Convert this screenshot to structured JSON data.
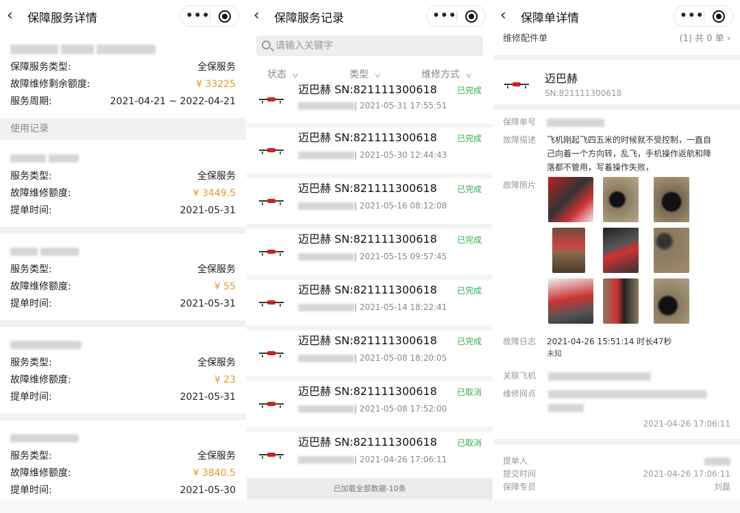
{
  "panel1": {
    "title": "保障服务详情",
    "rows": [
      {
        "label": "保障服务类型:",
        "value": "全保服务"
      },
      {
        "label": "故障维修剩余额度:",
        "value": "¥ 33225"
      },
      {
        "label": "服务周期:",
        "value": "2021-04-21 ~ 2022-04-21"
      }
    ],
    "section_title": "使用记录",
    "records": [
      {
        "type_label": "服务类型:",
        "type": "全保服务",
        "amount_label": "故障维修额度:",
        "amount": "¥ 3449.5",
        "time_label": "提单时间:",
        "time": "2021-05-31"
      },
      {
        "type_label": "服务类型:",
        "type": "全保服务",
        "amount_label": "故障维修额度:",
        "amount": "¥ 55",
        "time_label": "提单时间:",
        "time": "2021-05-31"
      },
      {
        "type_label": "服务类型:",
        "type": "全保服务",
        "amount_label": "故障维修额度:",
        "amount": "¥ 23",
        "time_label": "提单时间:",
        "time": "2021-05-31"
      },
      {
        "type_label": "服务类型:",
        "type": "全保服务",
        "amount_label": "故障维修额度:",
        "amount": "¥ 3840.5",
        "time_label": "提单时间:",
        "time": "2021-05-30"
      }
    ]
  },
  "panel2": {
    "title": "保障服务记录",
    "search_placeholder": "请输入关键字",
    "filters": [
      "状态",
      "类型",
      "维修方式"
    ],
    "items": [
      {
        "title": "迈巴赫 SN:821111300618",
        "time": "| 2021-05-31 17:55:51",
        "status": "已完成"
      },
      {
        "title": "迈巴赫 SN:821111300618",
        "time": "| 2021-05-30 12:44:43",
        "status": "已完成"
      },
      {
        "title": "迈巴赫 SN:821111300618",
        "time": "| 2021-05-16 08:12:08",
        "status": "已完成"
      },
      {
        "title": "迈巴赫 SN:821111300618",
        "time": "| 2021-05-15 09:57:45",
        "status": "已完成"
      },
      {
        "title": "迈巴赫 SN:821111300618",
        "time": "| 2021-05-14 18:22:41",
        "status": "已完成"
      },
      {
        "title": "迈巴赫 SN:821111300618",
        "time": "| 2021-05-08 18:20:05",
        "status": "已完成"
      },
      {
        "title": "迈巴赫 SN:821111300618",
        "time": "| 2021-05-08 17:52:00",
        "status": "已取消"
      },
      {
        "title": "迈巴赫 SN:821111300618",
        "time": "| 2021-04-26 17:06:11",
        "status": "已取消"
      }
    ],
    "footer": "已加载全部数据-10条"
  },
  "panel3": {
    "title": "保障单详情",
    "parts_label": "维修配件单",
    "parts_count": "(1) 共 0 单 ›",
    "drone_name": "迈巴赫",
    "drone_sn": "SN:821111300618",
    "labels": {
      "order_no": "保障单号",
      "fault_desc": "故障描述",
      "fault_photos": "故障照片",
      "fault_log": "故障日志",
      "linked_drone": "关联飞机",
      "repair_site": "维修网点",
      "submitter": "提单人",
      "submit_time": "提交时间",
      "specialist": "保障专员"
    },
    "fault_desc_lines": [
      "飞机刚起飞四五米的时候就不受控制，一直自",
      "己向着一个方向转，乱飞，手机操作返航和降",
      "落都不管用，写着操作失败，"
    ],
    "fault_log_line": "2021-04-26 15:51:14 时长47秒",
    "fault_log_sub": "未知",
    "section_time": "2021-04-26 17:06:11",
    "submit_time": "2021-04-26 17:06:11",
    "specialist": "刘磊"
  }
}
